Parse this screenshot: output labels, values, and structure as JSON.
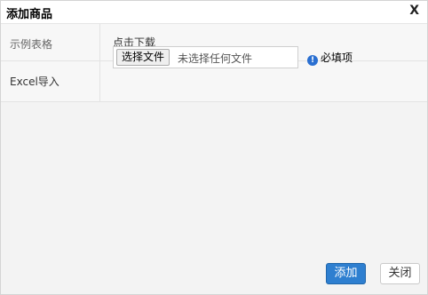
{
  "dialog": {
    "title": "添加商品",
    "close_label": "X"
  },
  "form": {
    "rows": [
      {
        "label": "示例表格",
        "link_text": "点击下载"
      },
      {
        "label": "Excel导入",
        "file_button_label": "选择文件",
        "file_status": "未选择任何文件",
        "required_icon": "info-circle-icon",
        "required_text": "必填项"
      }
    ]
  },
  "footer": {
    "add_label": "添加",
    "close_label": "关闭"
  },
  "colors": {
    "primary_button": "#2e7fd0",
    "info_icon": "#2a6fd1"
  }
}
